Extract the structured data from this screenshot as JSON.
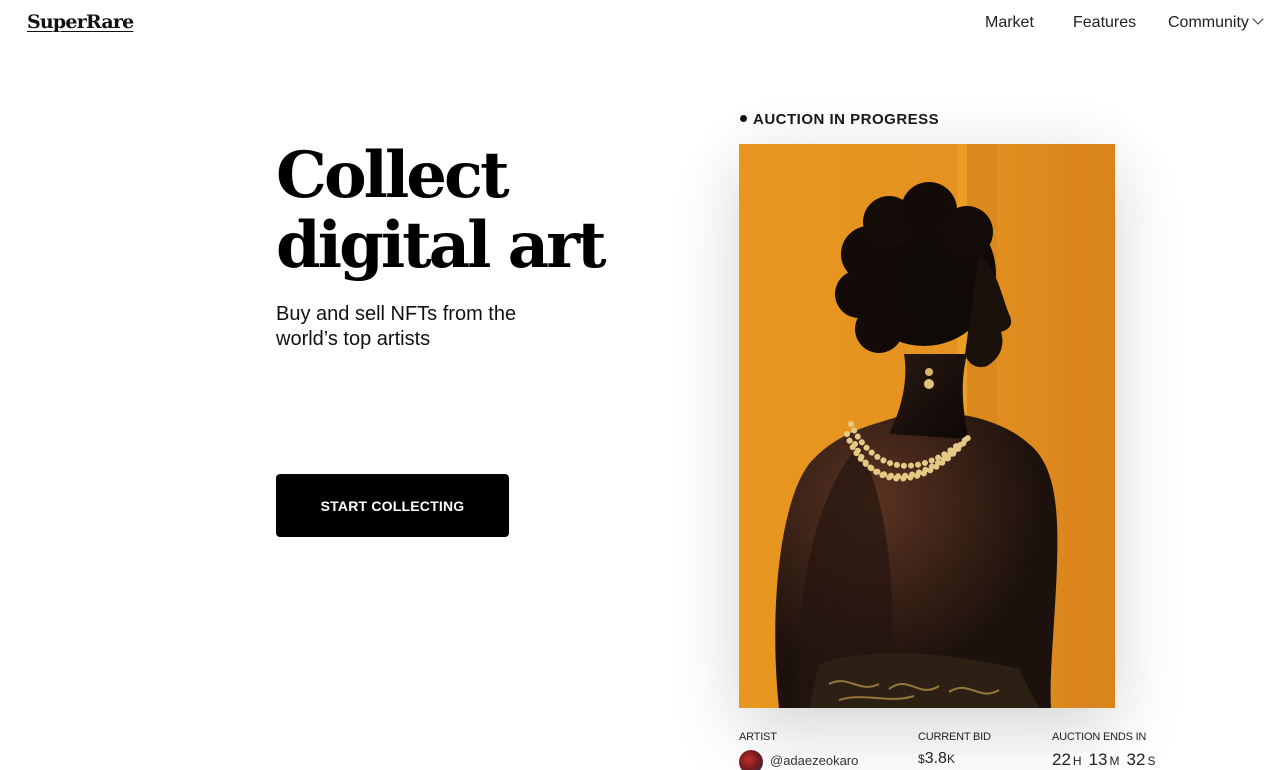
{
  "header": {
    "logo": "SuperRare",
    "nav": {
      "market": "Market",
      "features": "Features",
      "community": "Community"
    }
  },
  "hero": {
    "title_line1": "Collect",
    "title_line2": "digital art",
    "subtitle": "Buy and sell NFTs from the world’s top artists",
    "cta": "START COLLECTING"
  },
  "auction": {
    "status": "AUCTION IN PROGRESS",
    "artwork_icon": "portrait-artwork",
    "labels": {
      "artist": "ARTIST",
      "current_bid": "CURRENT BID",
      "ends_in": "AUCTION ENDS IN"
    },
    "artist_handle": "@adaezeokaro",
    "bid": {
      "currency": "$",
      "amount": "3.8",
      "suffix": "K"
    },
    "timer": {
      "hours": "22",
      "hours_unit": "H",
      "minutes": "13",
      "minutes_unit": "M",
      "seconds": "32",
      "seconds_unit": "S"
    }
  },
  "colors": {
    "background": "#ffffff",
    "text": "#111111",
    "cta_background": "#000000",
    "cta_text": "#ffffff",
    "artwork_background": "#e0931f"
  }
}
